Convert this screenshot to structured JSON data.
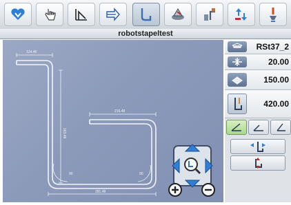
{
  "toolbar": {
    "tabs": [
      {
        "icon": "heart-badge-icon",
        "active": false
      },
      {
        "icon": "hand-pointer-icon",
        "active": false
      },
      {
        "icon": "bend-angle-icon",
        "active": false
      },
      {
        "icon": "feed-arrow-icon",
        "active": false
      },
      {
        "icon": "bent-part-icon",
        "active": true
      },
      {
        "icon": "machine-icon",
        "active": false
      },
      {
        "icon": "robot-stack-icon",
        "active": false
      },
      {
        "icon": "arrows-updown-icon",
        "active": false
      },
      {
        "icon": "tool-icon",
        "active": false
      }
    ]
  },
  "header": {
    "title": "robotstapeltest"
  },
  "drawing": {
    "dim_top_left": "124.46",
    "dim_vertical": "163.48",
    "dim_upper_right": "216.48",
    "dim_bottom": "281.48",
    "angle_left": "90",
    "angle_right": "90"
  },
  "panel": {
    "material": "RSt37_2",
    "thickness": "20.00",
    "width": "150.00",
    "length": "420.00"
  },
  "colors": {
    "accent_blue": "#2f7fd6",
    "active_mode_green": "#a9d98d",
    "drawing_bg": "#8c9aba"
  }
}
